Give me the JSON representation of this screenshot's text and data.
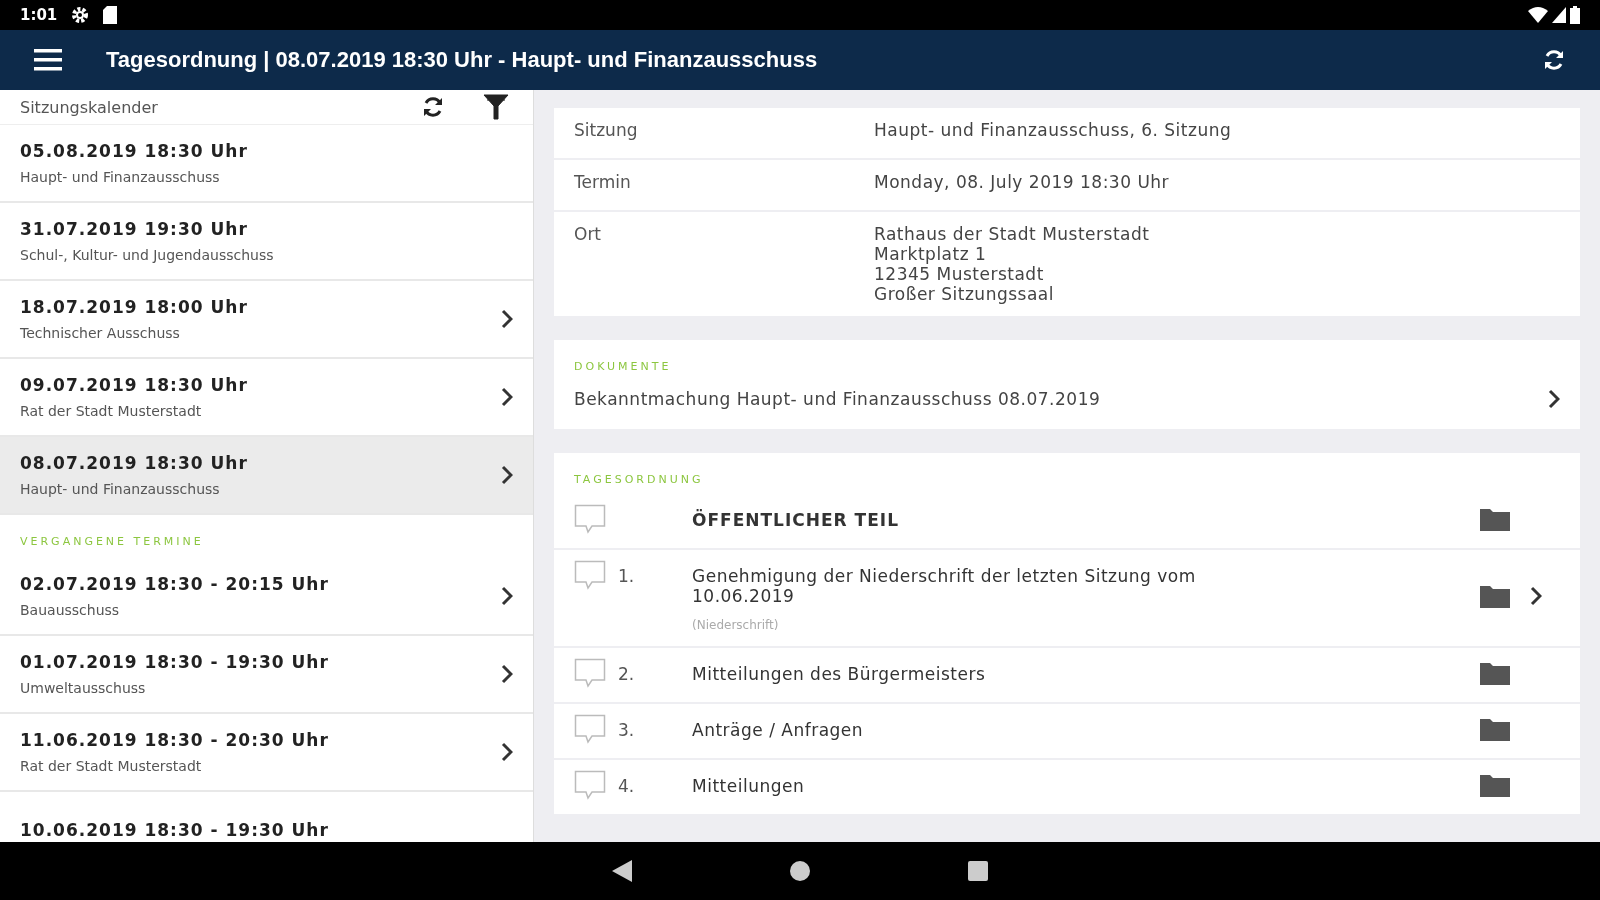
{
  "status_bar": {
    "time": "1:01"
  },
  "app_bar": {
    "title": "Tagesordnung | 08.07.2019 18:30 Uhr - Haupt- und Finanzausschuss"
  },
  "calendar": {
    "title": "Sitzungskalender",
    "upcoming": [
      {
        "date": "05.08.2019 18:30 Uhr",
        "committee": "Haupt- und Finanzausschuss",
        "has_arrow": false,
        "selected": false
      },
      {
        "date": "31.07.2019 19:30 Uhr",
        "committee": "Schul-, Kultur- und Jugendausschuss",
        "has_arrow": false,
        "selected": false
      },
      {
        "date": "18.07.2019 18:00 Uhr",
        "committee": "Technischer Ausschuss",
        "has_arrow": true,
        "selected": false
      },
      {
        "date": "09.07.2019 18:30 Uhr",
        "committee": "Rat der Stadt Musterstadt",
        "has_arrow": true,
        "selected": false
      },
      {
        "date": "08.07.2019 18:30 Uhr",
        "committee": "Haupt- und Finanzausschuss",
        "has_arrow": true,
        "selected": true
      }
    ],
    "past_header": "VERGANGENE TERMINE",
    "past": [
      {
        "date": "02.07.2019 18:30 - 20:15 Uhr",
        "committee": "Bauausschuss",
        "has_arrow": true,
        "selected": false
      },
      {
        "date": "01.07.2019 18:30 - 19:30 Uhr",
        "committee": "Umweltausschuss",
        "has_arrow": true,
        "selected": false
      },
      {
        "date": "11.06.2019 18:30 - 20:30 Uhr",
        "committee": "Rat der Stadt Musterstadt",
        "has_arrow": true,
        "selected": false
      },
      {
        "date": "10.06.2019 18:30 - 19:30 Uhr",
        "has_arrow": false,
        "selected": false
      }
    ]
  },
  "details": [
    {
      "label": "Sitzung",
      "lines": [
        "Haupt- und Finanzausschuss, 6. Sitzung"
      ]
    },
    {
      "label": "Termin",
      "lines": [
        "Monday, 08. July 2019 18:30 Uhr"
      ]
    },
    {
      "label": "Ort",
      "lines": [
        "Rathaus der Stadt Musterstadt",
        "Marktplatz 1",
        "12345 Musterstadt",
        "Großer Sitzungssaal"
      ]
    }
  ],
  "documents": {
    "header": "DOKUMENTE",
    "items": [
      "Bekanntmachung Haupt- und Finanzausschuss 08.07.2019"
    ]
  },
  "agenda": {
    "header": "TAGESORDNUNG",
    "items": [
      {
        "kind": "section",
        "title": "ÖFFENTLICHER TEIL",
        "has_arrow": false
      },
      {
        "kind": "item",
        "number": "1.",
        "title": "Genehmigung der Niederschrift der letzten Sitzung vom 10.06.2019",
        "note": "(Niederschrift)",
        "has_arrow": true
      },
      {
        "kind": "item",
        "number": "2.",
        "title": "Mitteilungen des Bürgermeisters",
        "has_arrow": false
      },
      {
        "kind": "item",
        "number": "3.",
        "title": "Anträge / Anfragen",
        "has_arrow": false
      },
      {
        "kind": "item",
        "number": "4.",
        "title": "Mitteilungen",
        "has_arrow": false
      }
    ]
  }
}
